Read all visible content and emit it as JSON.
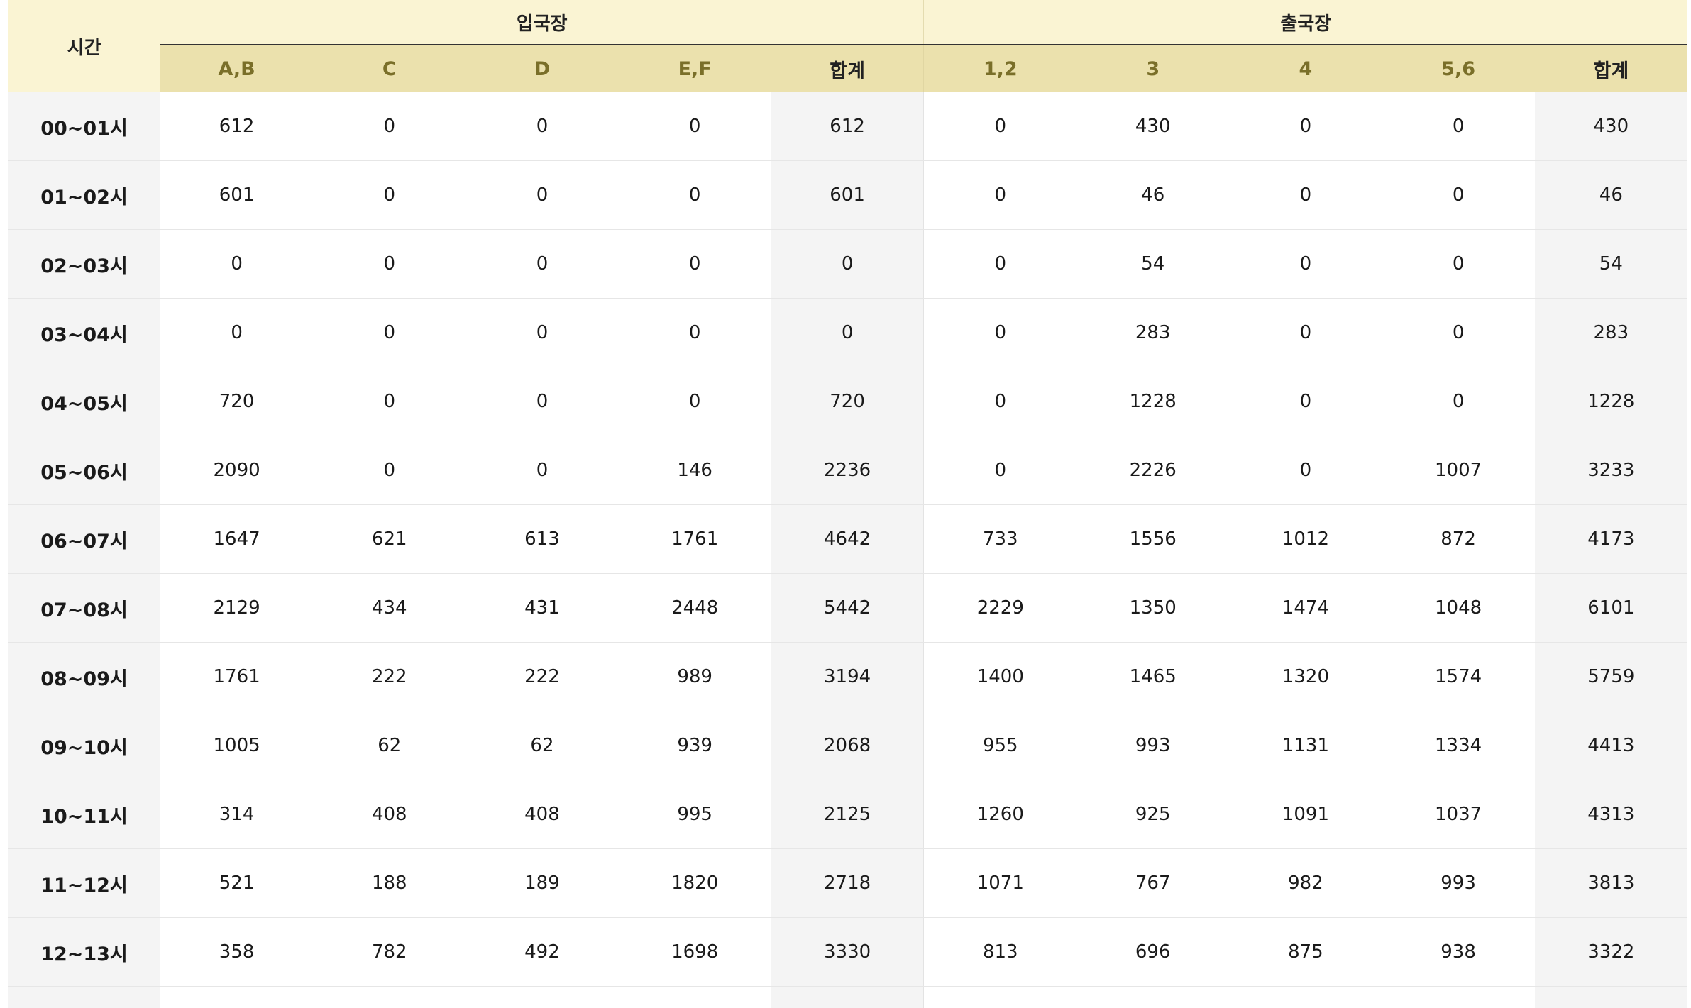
{
  "table": {
    "time_header": "시간",
    "entry_group": "입국장",
    "exit_group": "출국장",
    "entry_columns": [
      "A,B",
      "C",
      "D",
      "E,F",
      "합계"
    ],
    "exit_columns": [
      "1,2",
      "3",
      "4",
      "5,6",
      "합계"
    ],
    "rows": [
      {
        "time": "00~01시",
        "entry": [
          "612",
          "0",
          "0",
          "0",
          "612"
        ],
        "exit": [
          "0",
          "430",
          "0",
          "0",
          "430"
        ]
      },
      {
        "time": "01~02시",
        "entry": [
          "601",
          "0",
          "0",
          "0",
          "601"
        ],
        "exit": [
          "0",
          "46",
          "0",
          "0",
          "46"
        ]
      },
      {
        "time": "02~03시",
        "entry": [
          "0",
          "0",
          "0",
          "0",
          "0"
        ],
        "exit": [
          "0",
          "54",
          "0",
          "0",
          "54"
        ]
      },
      {
        "time": "03~04시",
        "entry": [
          "0",
          "0",
          "0",
          "0",
          "0"
        ],
        "exit": [
          "0",
          "283",
          "0",
          "0",
          "283"
        ]
      },
      {
        "time": "04~05시",
        "entry": [
          "720",
          "0",
          "0",
          "0",
          "720"
        ],
        "exit": [
          "0",
          "1228",
          "0",
          "0",
          "1228"
        ]
      },
      {
        "time": "05~06시",
        "entry": [
          "2090",
          "0",
          "0",
          "146",
          "2236"
        ],
        "exit": [
          "0",
          "2226",
          "0",
          "1007",
          "3233"
        ]
      },
      {
        "time": "06~07시",
        "entry": [
          "1647",
          "621",
          "613",
          "1761",
          "4642"
        ],
        "exit": [
          "733",
          "1556",
          "1012",
          "872",
          "4173"
        ]
      },
      {
        "time": "07~08시",
        "entry": [
          "2129",
          "434",
          "431",
          "2448",
          "5442"
        ],
        "exit": [
          "2229",
          "1350",
          "1474",
          "1048",
          "6101"
        ]
      },
      {
        "time": "08~09시",
        "entry": [
          "1761",
          "222",
          "222",
          "989",
          "3194"
        ],
        "exit": [
          "1400",
          "1465",
          "1320",
          "1574",
          "5759"
        ]
      },
      {
        "time": "09~10시",
        "entry": [
          "1005",
          "62",
          "62",
          "939",
          "2068"
        ],
        "exit": [
          "955",
          "993",
          "1131",
          "1334",
          "4413"
        ]
      },
      {
        "time": "10~11시",
        "entry": [
          "314",
          "408",
          "408",
          "995",
          "2125"
        ],
        "exit": [
          "1260",
          "925",
          "1091",
          "1037",
          "4313"
        ]
      },
      {
        "time": "11~12시",
        "entry": [
          "521",
          "188",
          "189",
          "1820",
          "2718"
        ],
        "exit": [
          "1071",
          "767",
          "982",
          "993",
          "3813"
        ]
      },
      {
        "time": "12~13시",
        "entry": [
          "358",
          "782",
          "492",
          "1698",
          "3330"
        ],
        "exit": [
          "813",
          "696",
          "875",
          "938",
          "3322"
        ]
      }
    ]
  }
}
